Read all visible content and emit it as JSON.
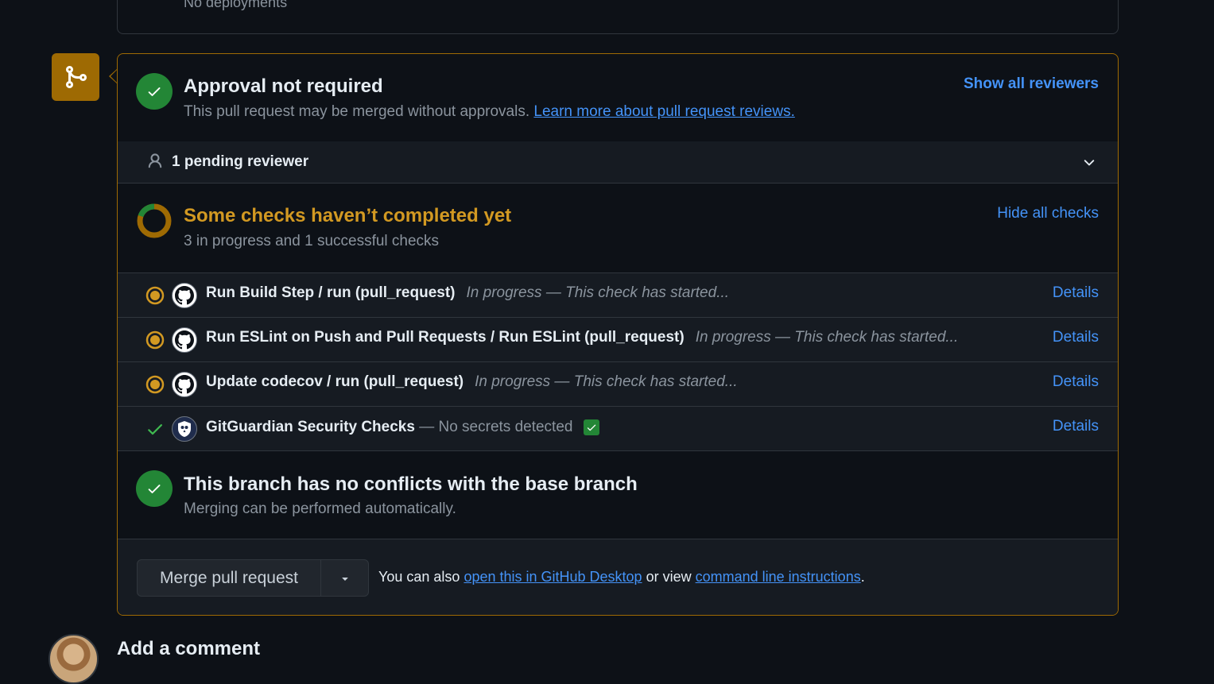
{
  "deployments": {
    "text": "No deployments"
  },
  "approval": {
    "title": "Approval not required",
    "subtitle": "This pull request may be merged without approvals.",
    "learn_more_link": "Learn more about pull request reviews.",
    "show_reviewers_link": "Show all reviewers"
  },
  "reviewers": {
    "pending_text": "1 pending reviewer"
  },
  "checks": {
    "title": "Some checks haven’t completed yet",
    "subtitle": "3 in progress and 1 successful checks",
    "hide_link": "Hide all checks",
    "details_label": "Details",
    "items": [
      {
        "status": "in-progress",
        "app_icon": "github-icon",
        "name": "Run Build Step / run (pull_request)",
        "description": "In progress — This check has started..."
      },
      {
        "status": "in-progress",
        "app_icon": "github-icon",
        "name": "Run ESLint on Push and Pull Requests / Run ESLint (pull_request)",
        "description": "In progress — This check has started..."
      },
      {
        "status": "in-progress",
        "app_icon": "github-icon",
        "name": "Update codecov / run (pull_request)",
        "description": "In progress — This check has started..."
      },
      {
        "status": "success",
        "app_icon": "gitguardian-icon",
        "name": "GitGuardian Security Checks",
        "description": "— No secrets detected"
      }
    ]
  },
  "conflicts": {
    "title": "This branch has no conflicts with the base branch",
    "subtitle": "Merging can be performed automatically."
  },
  "merge": {
    "button_label": "Merge pull request",
    "also_text": "You can also",
    "desktop_link": "open this in GitHub Desktop",
    "or_view_text": "or view",
    "cli_link": "command line instructions",
    "period": "."
  },
  "comment": {
    "title": "Add a comment"
  },
  "colors": {
    "background": "#0d1117",
    "panel": "#161b22",
    "border": "#30363d",
    "attention": "#9e6a03",
    "attention_text": "#d29922",
    "success": "#238636",
    "link": "#4493f8",
    "muted": "#8b949e"
  }
}
